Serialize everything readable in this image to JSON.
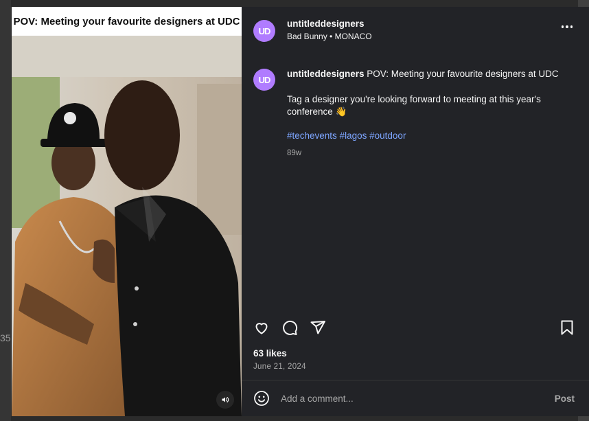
{
  "media": {
    "caption_overlay": "POV: Meeting your favourite designers at UDC",
    "sound_icon": "speaker-icon"
  },
  "author": {
    "avatar_text": "UD",
    "username": "untitleddesigners",
    "subline": "Bad Bunny • MONACO"
  },
  "caption": {
    "username": "untitleddesigners",
    "title": "POV: Meeting your favourite designers at UDC",
    "body": "Tag a designer you're looking forward to meeting at this year's conference",
    "emoji": "👋",
    "hashtags": [
      "#techevents",
      "#lagos",
      "#outdoor"
    ],
    "time_ago": "89w"
  },
  "actions": {
    "like_icon": "heart-icon",
    "comment_icon": "comment-icon",
    "share_icon": "share-icon",
    "save_icon": "bookmark-icon"
  },
  "stats": {
    "likes": "63 likes",
    "date": "June 21, 2024"
  },
  "comment": {
    "placeholder": "Add a comment...",
    "post_label": "Post",
    "emoji_icon": "smiley-icon"
  },
  "backdrop": {
    "count_fragment": "35"
  },
  "colors": {
    "panel_bg": "#222327",
    "accent_hashtag": "#7da5ff",
    "avatar_bg": "#b07cff"
  }
}
